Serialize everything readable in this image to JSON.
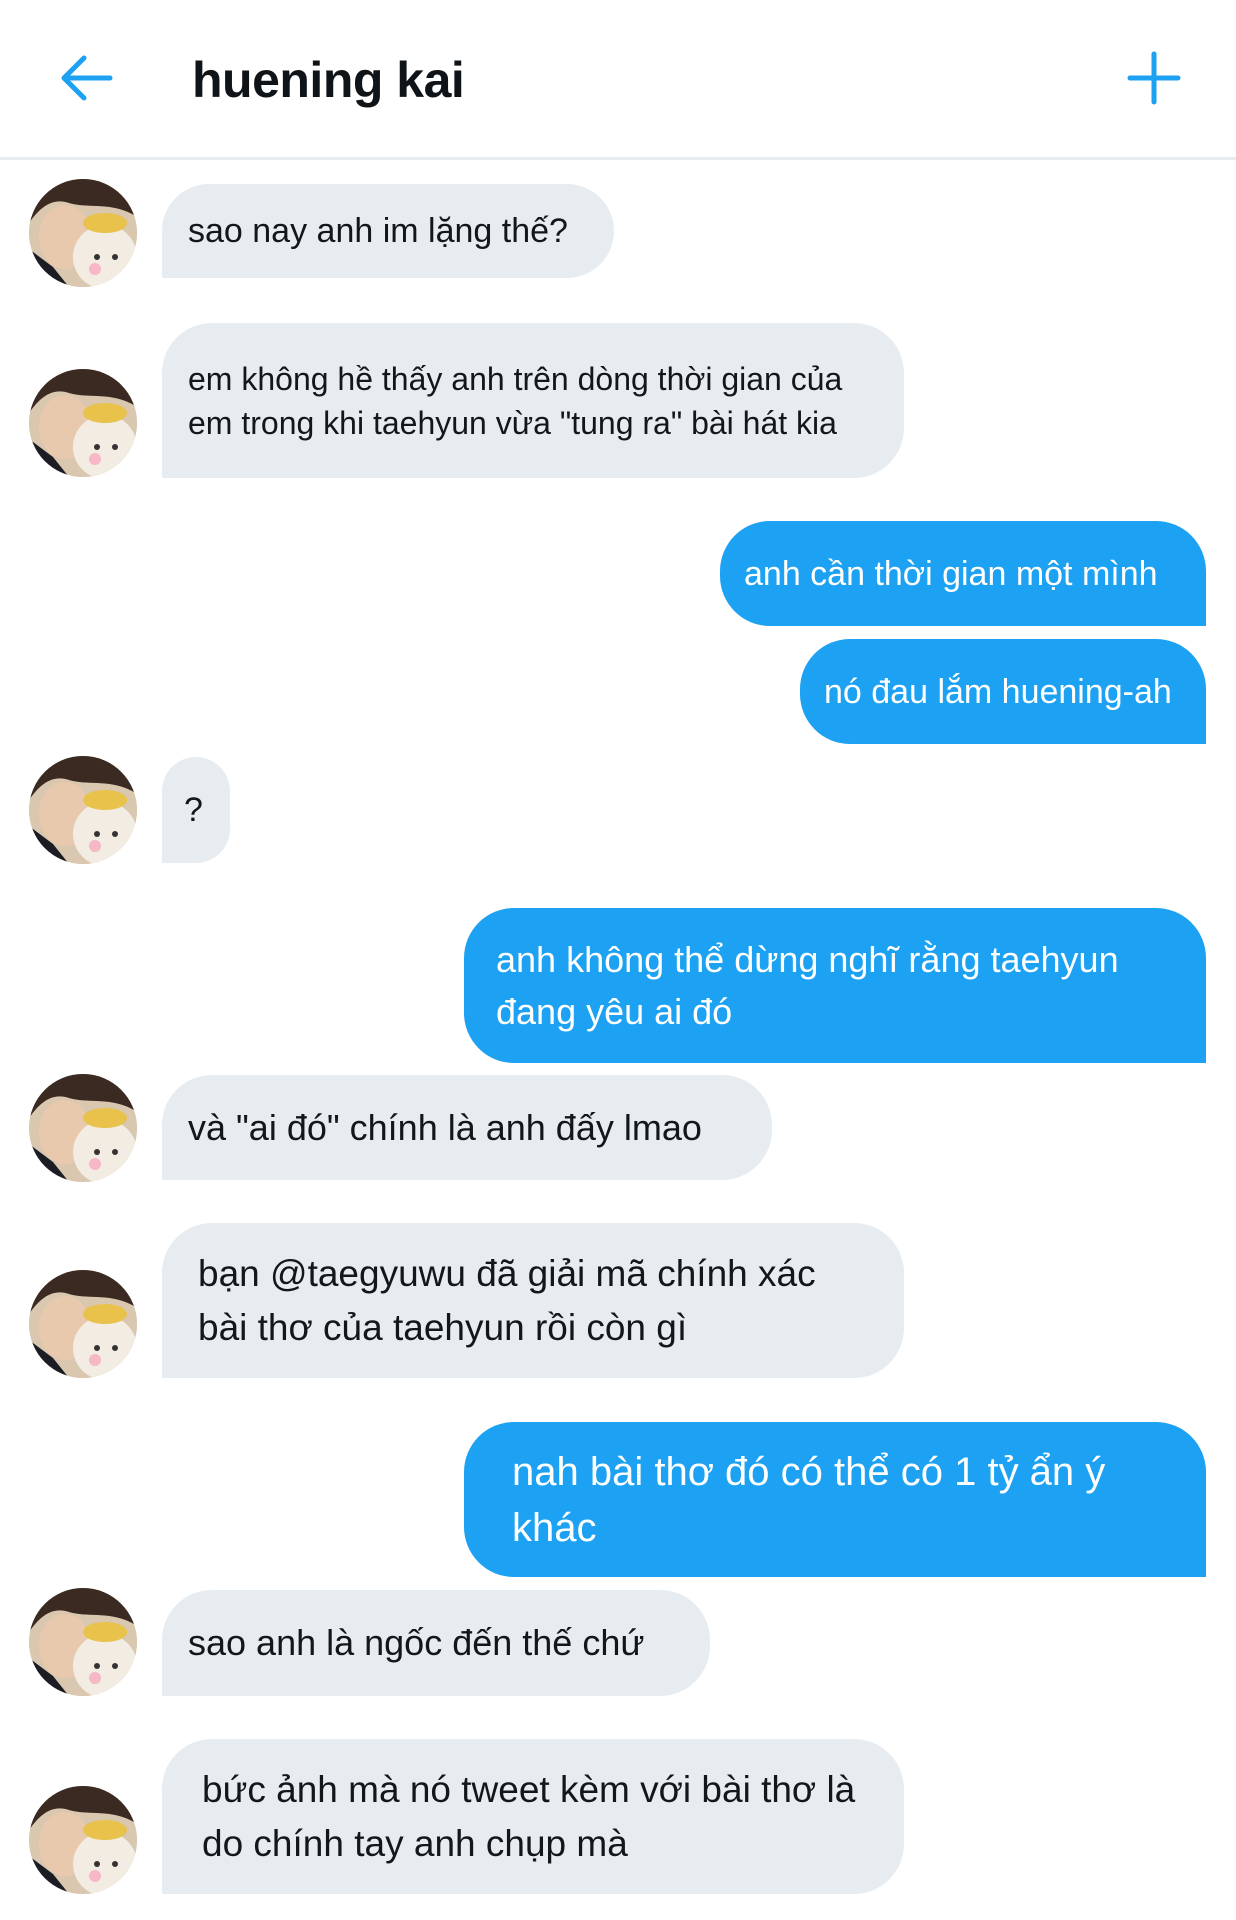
{
  "header": {
    "title": "huening kai",
    "back_icon": "arrow-left-icon",
    "add_icon": "plus-icon",
    "accent": "#1da1f2"
  },
  "messages": [
    {
      "side": "in",
      "text": "sao nay anh im lặng thế?"
    },
    {
      "side": "in",
      "text": "em không hề thấy anh trên dòng thời gian của em trong khi taehyun vừa \"tung ra\" bài hát kia"
    },
    {
      "side": "out",
      "text": "anh cần thời gian một mình"
    },
    {
      "side": "out",
      "text": "nó đau lắm huening-ah"
    },
    {
      "side": "in",
      "text": "?"
    },
    {
      "side": "out",
      "text": "anh không thể dừng nghĩ rằng taehyun đang yêu ai đó"
    },
    {
      "side": "in",
      "text": "và \"ai đó\" chính là anh đấy lmao"
    },
    {
      "side": "in",
      "text": "bạn @taegyuwu đã giải mã chính xác bài thơ của taehyun rồi còn gì"
    },
    {
      "side": "out",
      "text": "nah bài thơ đó có thể có 1 tỷ ẩn ý khác"
    },
    {
      "side": "in",
      "text": "sao anh là ngốc đến thế chứ"
    },
    {
      "side": "in",
      "text": "bức ảnh mà nó tweet kèm với bài thơ là do chính tay anh chụp mà"
    }
  ],
  "colors": {
    "incoming_bubble": "#e6ecf0",
    "outgoing_bubble": "#1da1f2"
  }
}
